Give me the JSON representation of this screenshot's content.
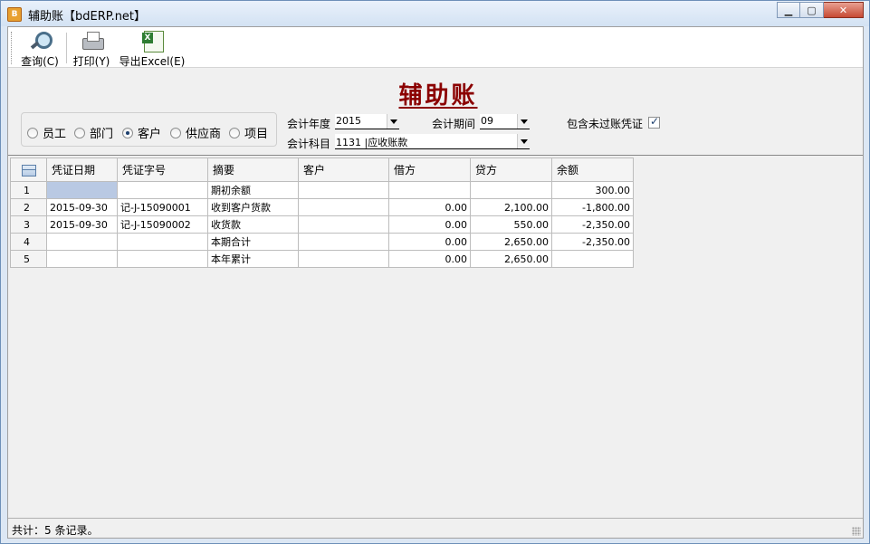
{
  "window": {
    "title": "辅助账【bdERP.net】"
  },
  "toolbar": {
    "query": "查询(C)",
    "print": "打印(Y)",
    "export": "导出Excel(E)"
  },
  "report": {
    "title": "辅助账"
  },
  "filters": {
    "types": [
      "员工",
      "部门",
      "客户",
      "供应商",
      "项目"
    ],
    "selected_type": "客户",
    "year_label": "会计年度",
    "year_value": "2015",
    "period_label": "会计期间",
    "period_value": "09",
    "subject_label": "会计科目",
    "subject_value": "1131 |应收账款",
    "include_label": "包含未过账凭证",
    "include_checked": true
  },
  "table": {
    "columns": [
      "凭证日期",
      "凭证字号",
      "摘要",
      "客户",
      "借方",
      "贷方",
      "余额"
    ],
    "rows": [
      {
        "no": "1",
        "date": "",
        "voucher": "",
        "summary": "期初余额",
        "customer": "",
        "debit": "",
        "credit": "",
        "balance": "300.00"
      },
      {
        "no": "2",
        "date": "2015-09-30",
        "voucher": "记-J-15090001",
        "summary": "收到客户货款",
        "customer": "",
        "debit": "0.00",
        "credit": "2,100.00",
        "balance": "-1,800.00"
      },
      {
        "no": "3",
        "date": "2015-09-30",
        "voucher": "记-J-15090002",
        "summary": "收货款",
        "customer": "",
        "debit": "0.00",
        "credit": "550.00",
        "balance": "-2,350.00"
      },
      {
        "no": "4",
        "date": "",
        "voucher": "",
        "summary": "本期合计",
        "customer": "",
        "debit": "0.00",
        "credit": "2,650.00",
        "balance": "-2,350.00"
      },
      {
        "no": "5",
        "date": "",
        "voucher": "",
        "summary": "本年累计",
        "customer": "",
        "debit": "0.00",
        "credit": "2,650.00",
        "balance": ""
      }
    ]
  },
  "status": {
    "text": "共计：5 条记录。"
  }
}
